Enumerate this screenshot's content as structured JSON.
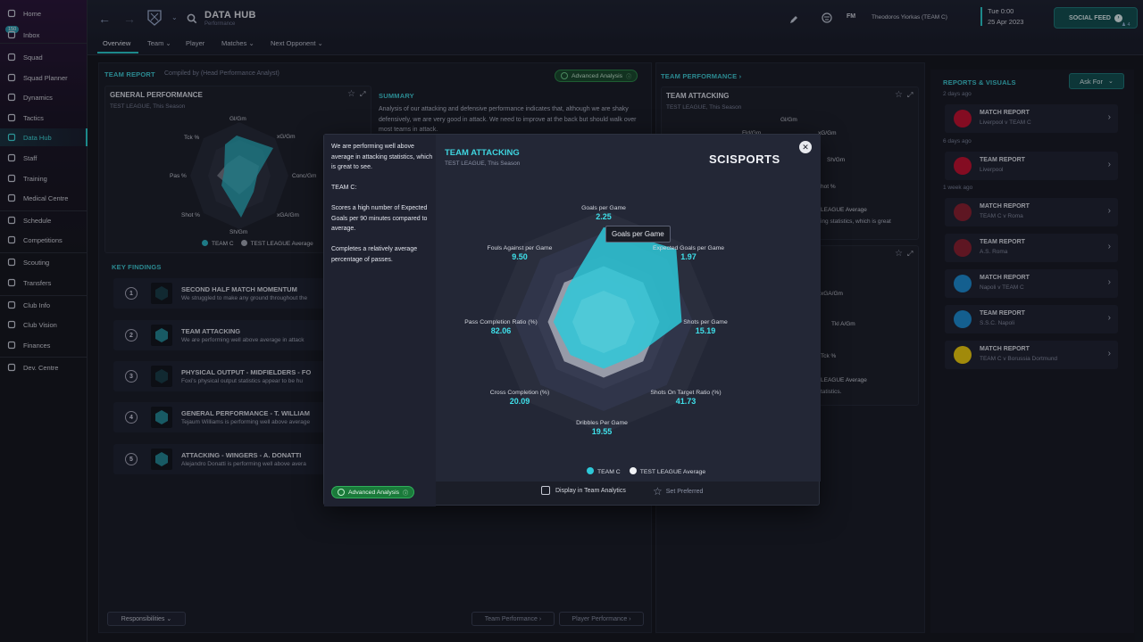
{
  "sidebar": {
    "inbox_badge": "150",
    "items": [
      {
        "label": "Home",
        "icon": "home-icon"
      },
      {
        "label": "Inbox",
        "icon": "inbox-icon"
      },
      {
        "label": "Squad",
        "icon": "squad-icon"
      },
      {
        "label": "Squad Planner",
        "icon": "squad-planner-icon"
      },
      {
        "label": "Dynamics",
        "icon": "dynamics-icon"
      },
      {
        "label": "Tactics",
        "icon": "tactics-icon"
      },
      {
        "label": "Data Hub",
        "icon": "data-hub-icon"
      },
      {
        "label": "Staff",
        "icon": "staff-icon"
      },
      {
        "label": "Training",
        "icon": "training-icon"
      },
      {
        "label": "Medical Centre",
        "icon": "medical-icon"
      },
      {
        "label": "Schedule",
        "icon": "schedule-icon"
      },
      {
        "label": "Competitions",
        "icon": "trophy-icon"
      },
      {
        "label": "Scouting",
        "icon": "scouting-icon"
      },
      {
        "label": "Transfers",
        "icon": "transfers-icon"
      },
      {
        "label": "Club Info",
        "icon": "club-info-icon"
      },
      {
        "label": "Club Vision",
        "icon": "club-vision-icon"
      },
      {
        "label": "Finances",
        "icon": "finances-icon"
      },
      {
        "label": "Dev. Centre",
        "icon": "dev-centre-icon"
      }
    ]
  },
  "header": {
    "title": "DATA HUB",
    "subtitle": "Performance",
    "tabs": [
      "Overview",
      "Team",
      "Player",
      "Matches",
      "Next Opponent"
    ],
    "manager": "Theodoros Yiorkas (TEAM C)",
    "fm_logo": "FM",
    "date_time": "Tue 0:00",
    "date": "25 Apr 2023",
    "social_feed": "SOCIAL FEED",
    "social_count": "4"
  },
  "team_report": {
    "title": "TEAM REPORT",
    "compiled_by": "Compiled by (Head Performance Analyst)",
    "advanced_analysis": "Advanced Analysis",
    "general_performance": {
      "title": "GENERAL PERFORMANCE",
      "sub": "TEST LEAGUE, This Season",
      "axes": [
        "Gl/Gm",
        "xG/Gm",
        "Conc/Gm",
        "xGA/Gm",
        "Sh/Gm",
        "Shot %",
        "Pas %",
        "Tck %"
      ],
      "legend_team": "TEAM C",
      "legend_league": "TEST LEAGUE Average"
    },
    "summary_title": "SUMMARY",
    "summary_text": "Analysis of our attacking and defensive performance indicates that, although we are shaky defensively, we are very good in attack. We need to improve at the back but should walk over most teams in attack."
  },
  "key_findings": {
    "title": "KEY FINDINGS",
    "items": [
      {
        "num": "1",
        "title": "SECOND HALF MATCH MOMENTUM",
        "desc": "We struggled to make any ground throughout the"
      },
      {
        "num": "2",
        "title": "TEAM ATTACKING",
        "desc": "We are performing well above average in attack"
      },
      {
        "num": "3",
        "title": "PHYSICAL OUTPUT - MIDFIELDERS - FO",
        "desc": "Foxi's physical output statistics appear to be hu"
      },
      {
        "num": "4",
        "title": "GENERAL PERFORMANCE - T. WILLIAM",
        "desc": "Tejaum Williams is performing well above average"
      },
      {
        "num": "5",
        "title": "ATTACKING - WINGERS - A. DONATTI",
        "desc": "Alejandro Donatti is performing well above avera"
      }
    ]
  },
  "team_performance": {
    "title": "TEAM PERFORMANCE",
    "card_title": "TEAM ATTACKING",
    "card_sub": "TEST LEAGUE, This Season",
    "partial_labels": [
      "Gl/Gm",
      "Fld/Gm",
      "xG/Gm",
      "Sh/Gm",
      "hot %",
      "LEAGUE Average",
      "ing statistics, which is great",
      "xGA/Gm",
      "Tkl A/Gm",
      "Tck %",
      "LEAGUE Average",
      "tatistics."
    ]
  },
  "reports": {
    "title": "REPORTS & VISUALS",
    "ask_for": "Ask For",
    "groups": [
      {
        "date": "2 days ago"
      },
      {
        "date": "6 days ago"
      },
      {
        "date": "1 week ago"
      }
    ],
    "items": [
      {
        "title": "MATCH REPORT",
        "sub": "Liverpool v TEAM C",
        "logo": "liverpool-logo-icon"
      },
      {
        "title": "TEAM REPORT",
        "sub": "Liverpool",
        "logo": "liverpool-logo-icon"
      },
      {
        "title": "MATCH REPORT",
        "sub": "TEAM C v Roma",
        "logo": "roma-logo-icon"
      },
      {
        "title": "TEAM REPORT",
        "sub": "A.S. Roma",
        "logo": "roma-logo-icon"
      },
      {
        "title": "MATCH REPORT",
        "sub": "Napoli v TEAM C",
        "logo": "napoli-logo-icon"
      },
      {
        "title": "TEAM REPORT",
        "sub": "S.S.C. Napoli",
        "logo": "napoli-logo-icon"
      },
      {
        "title": "MATCH REPORT",
        "sub": "TEAM C v Borussia Dortmund",
        "logo": "dortmund-logo-icon"
      }
    ]
  },
  "footer": {
    "responsibilities": "Responsibilities",
    "team_performance_btn": "Team Performance",
    "player_performance_btn": "Player Performance"
  },
  "modal": {
    "text": "We are performing well above average in attacking statistics, which is great to see.\n\nTEAM C:\n\nScores a high number of Expected Goals per 90 minutes compared to average.\n\nCompletes a relatively average percentage of passes.",
    "title": "TEAM ATTACKING",
    "subtitle": "TEST LEAGUE, This Season",
    "brand": "SCISPORTS",
    "tooltip": "Goals per Game",
    "legend_team": "TEAM C",
    "legend_league": "TEST LEAGUE Average",
    "advanced_analysis": "Advanced Analysis",
    "display_in_team_analytics": "Display in Team Analytics",
    "set_preferred": "Set Preferred"
  },
  "chart_data": {
    "type": "radar",
    "axes": [
      "Goals per Game",
      "Expected Goals per Game",
      "Shots per Game",
      "Shots On Target Ratio (%)",
      "Dribbles Per Game",
      "Cross Completion (%)",
      "Pass Completion Ratio (%)",
      "Fouls Against per Game"
    ],
    "values_display": [
      "2.25",
      "1.97",
      "15.19",
      "41.73",
      "19.55",
      "20.09",
      "82.06",
      "9.50"
    ],
    "series": [
      {
        "name": "TEAM C",
        "values": [
          0.85,
          0.92,
          0.7,
          0.42,
          0.42,
          0.42,
          0.45,
          0.45
        ]
      },
      {
        "name": "TEST LEAGUE Average",
        "values": [
          0.5,
          0.5,
          0.5,
          0.5,
          0.5,
          0.5,
          0.5,
          0.5
        ]
      }
    ],
    "colors": {
      "team": "#2ec8d8",
      "league": "#d0d2da"
    }
  }
}
